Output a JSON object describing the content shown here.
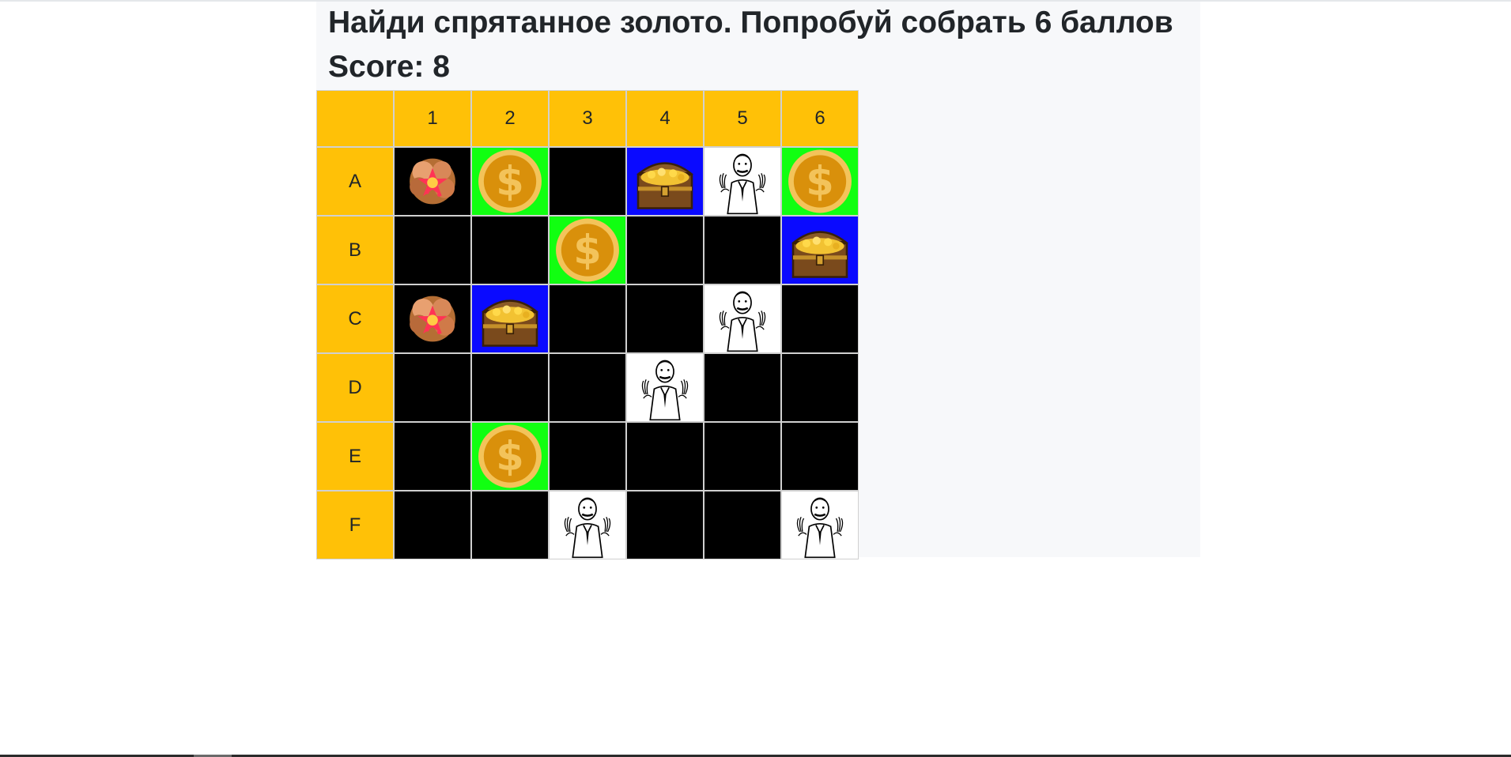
{
  "title": "Найди спрятанное золото. Попробуй собрать 6 баллов",
  "score_label": "Score: 8",
  "columns": [
    "1",
    "2",
    "3",
    "4",
    "5",
    "6"
  ],
  "rows": [
    {
      "label": "A",
      "cells": [
        "bomb",
        "coin",
        "hidden",
        "chest",
        "man",
        "coin"
      ]
    },
    {
      "label": "B",
      "cells": [
        "hidden",
        "hidden",
        "coin",
        "hidden",
        "hidden",
        "chest"
      ]
    },
    {
      "label": "C",
      "cells": [
        "bomb",
        "chest",
        "hidden",
        "hidden",
        "man",
        "hidden"
      ]
    },
    {
      "label": "D",
      "cells": [
        "hidden",
        "hidden",
        "hidden",
        "man",
        "hidden",
        "hidden"
      ]
    },
    {
      "label": "E",
      "cells": [
        "hidden",
        "coin",
        "hidden",
        "hidden",
        "hidden",
        "hidden"
      ]
    },
    {
      "label": "F",
      "cells": [
        "hidden",
        "hidden",
        "man",
        "hidden",
        "hidden",
        "man"
      ]
    }
  ],
  "colors": {
    "header": "#ffc107",
    "hidden": "#000000",
    "coin_bg": "#11ff11",
    "chest_bg": "#0a0aff",
    "man_bg": "#ffffff",
    "panel": "#f7f8fa"
  },
  "icons": {
    "coin": "dollar-coin-icon",
    "chest": "treasure-chest-icon",
    "man": "meme-man-icon",
    "bomb": "explosion-icon"
  }
}
